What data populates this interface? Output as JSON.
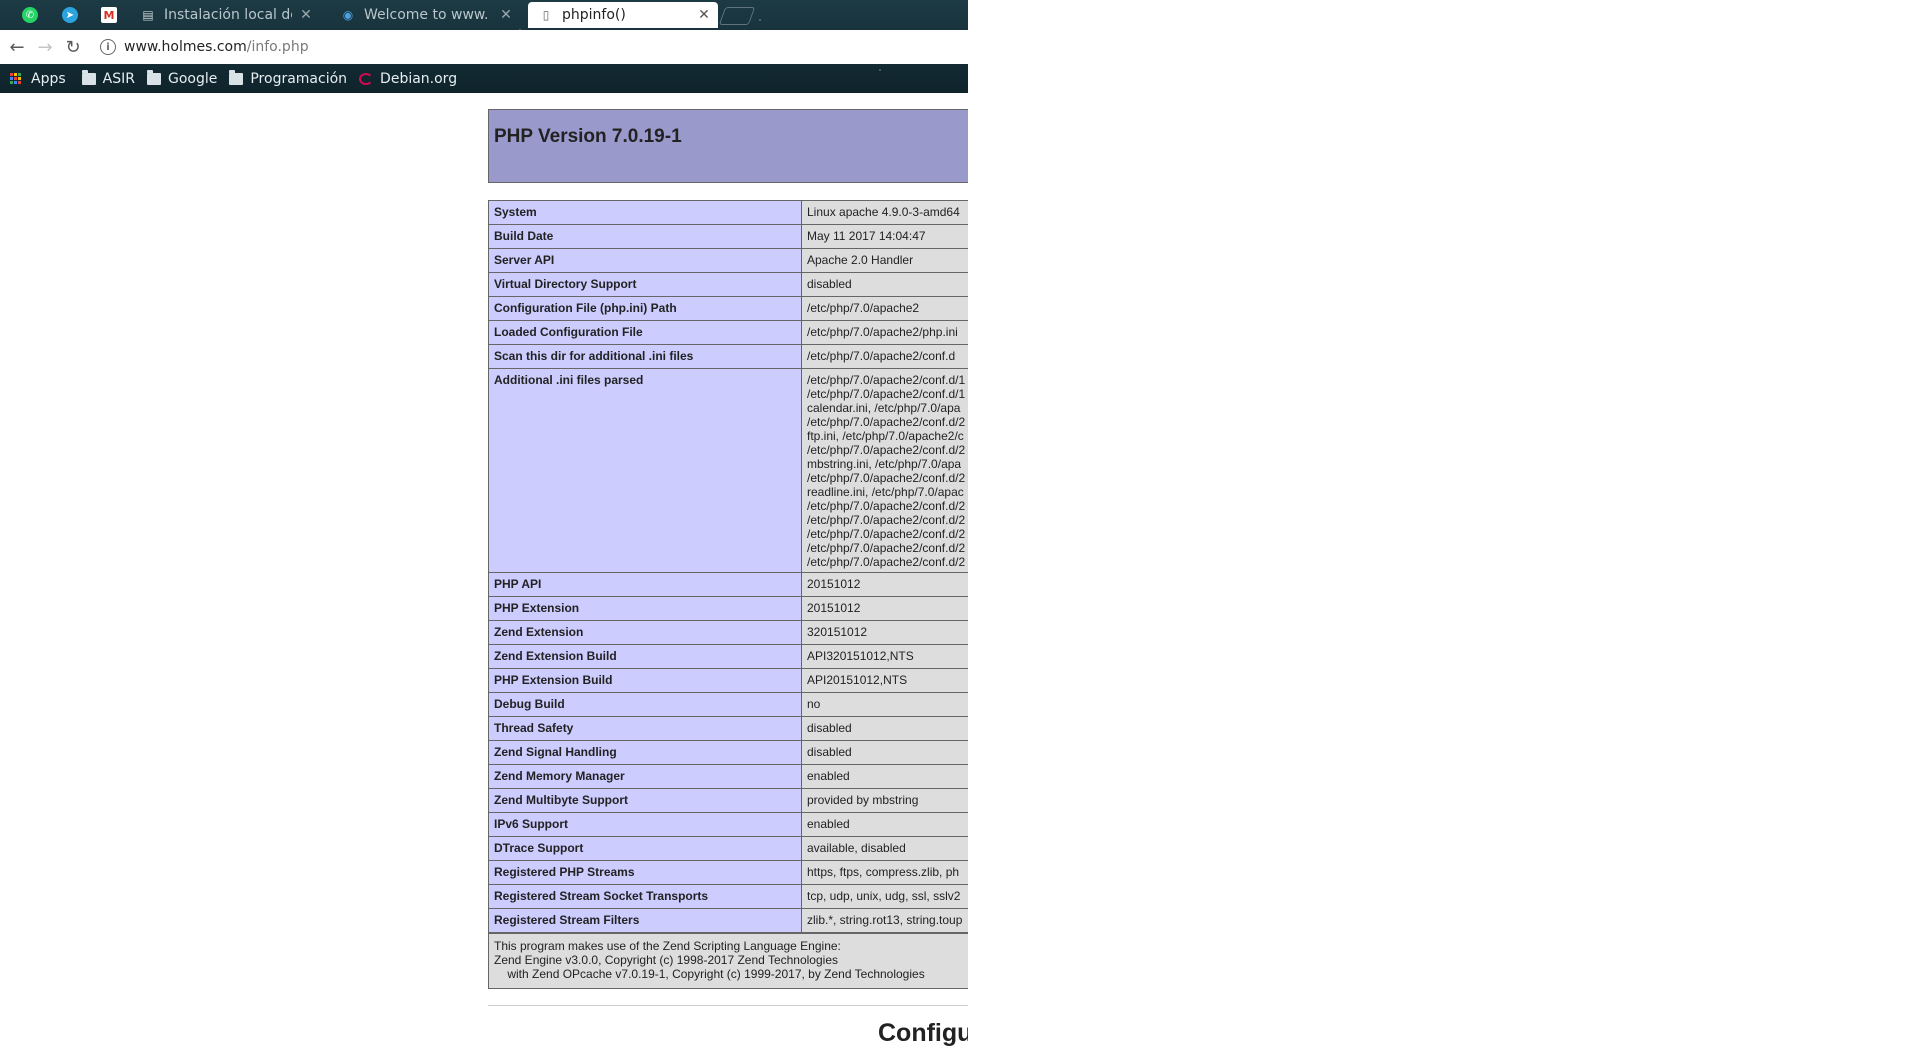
{
  "browser": {
    "tabs": [
      {
        "label": "Instalación local de",
        "icon": "document-icon"
      },
      {
        "label": "Welcome to www.",
        "icon": "globe-icon"
      },
      {
        "label": "phpinfo()",
        "icon": "page-icon",
        "active": true
      }
    ],
    "pinned": [
      "whatsapp-icon",
      "telegram-icon",
      "gmail-icon"
    ],
    "url": {
      "host": "www.holmes.com",
      "path": "/info.php"
    },
    "bookmarks": [
      {
        "label": "Apps",
        "icon": "apps-icon"
      },
      {
        "label": "ASIR",
        "icon": "folder-icon"
      },
      {
        "label": "Google",
        "icon": "folder-icon"
      },
      {
        "label": "Programación",
        "icon": "folder-icon"
      },
      {
        "label": "Debian.org",
        "icon": "debian-icon"
      }
    ]
  },
  "php": {
    "title": "PHP Version 7.0.19-1",
    "rows": [
      {
        "k": "System",
        "v": [
          "Linux apache 4.9.0-3-amd64"
        ]
      },
      {
        "k": "Build Date",
        "v": [
          "May 11 2017 14:04:47"
        ]
      },
      {
        "k": "Server API",
        "v": [
          "Apache 2.0 Handler"
        ]
      },
      {
        "k": "Virtual Directory Support",
        "v": [
          "disabled"
        ]
      },
      {
        "k": "Configuration File (php.ini) Path",
        "v": [
          "/etc/php/7.0/apache2"
        ]
      },
      {
        "k": "Loaded Configuration File",
        "v": [
          "/etc/php/7.0/apache2/php.ini"
        ]
      },
      {
        "k": "Scan this dir for additional .ini files",
        "v": [
          "/etc/php/7.0/apache2/conf.d"
        ]
      },
      {
        "k": "Additional .ini files parsed",
        "v": [
          "/etc/php/7.0/apache2/conf.d/1",
          "/etc/php/7.0/apache2/conf.d/1",
          "calendar.ini, /etc/php/7.0/apa",
          "/etc/php/7.0/apache2/conf.d/2",
          "ftp.ini, /etc/php/7.0/apache2/c",
          "/etc/php/7.0/apache2/conf.d/2",
          "mbstring.ini, /etc/php/7.0/apa",
          "/etc/php/7.0/apache2/conf.d/2",
          "readline.ini, /etc/php/7.0/apac",
          "/etc/php/7.0/apache2/conf.d/2",
          "/etc/php/7.0/apache2/conf.d/2",
          "/etc/php/7.0/apache2/conf.d/2",
          "/etc/php/7.0/apache2/conf.d/2",
          "/etc/php/7.0/apache2/conf.d/2"
        ]
      },
      {
        "k": "PHP API",
        "v": [
          "20151012"
        ]
      },
      {
        "k": "PHP Extension",
        "v": [
          "20151012"
        ]
      },
      {
        "k": "Zend Extension",
        "v": [
          "320151012"
        ]
      },
      {
        "k": "Zend Extension Build",
        "v": [
          "API320151012,NTS"
        ]
      },
      {
        "k": "PHP Extension Build",
        "v": [
          "API20151012,NTS"
        ]
      },
      {
        "k": "Debug Build",
        "v": [
          "no"
        ]
      },
      {
        "k": "Thread Safety",
        "v": [
          "disabled"
        ]
      },
      {
        "k": "Zend Signal Handling",
        "v": [
          "disabled"
        ]
      },
      {
        "k": "Zend Memory Manager",
        "v": [
          "enabled"
        ]
      },
      {
        "k": "Zend Multibyte Support",
        "v": [
          "provided by mbstring"
        ]
      },
      {
        "k": "IPv6 Support",
        "v": [
          "enabled"
        ]
      },
      {
        "k": "DTrace Support",
        "v": [
          "available, disabled"
        ]
      },
      {
        "k": "Registered PHP Streams",
        "v": [
          "https, ftps, compress.zlib, ph"
        ]
      },
      {
        "k": "Registered Stream Socket Transports",
        "v": [
          "tcp, udp, unix, udg, ssl, sslv2"
        ]
      },
      {
        "k": "Registered Stream Filters",
        "v": [
          "zlib.*, string.rot13, string.toup"
        ]
      }
    ],
    "credits": [
      "This program makes use of the Zend Scripting Language Engine:",
      "Zend Engine v3.0.0, Copyright (c) 1998-2017 Zend Technologies",
      "    with Zend OPcache v7.0.19-1, Copyright (c) 1999-2017, by Zend Technologies"
    ],
    "next_section": "Configu"
  }
}
